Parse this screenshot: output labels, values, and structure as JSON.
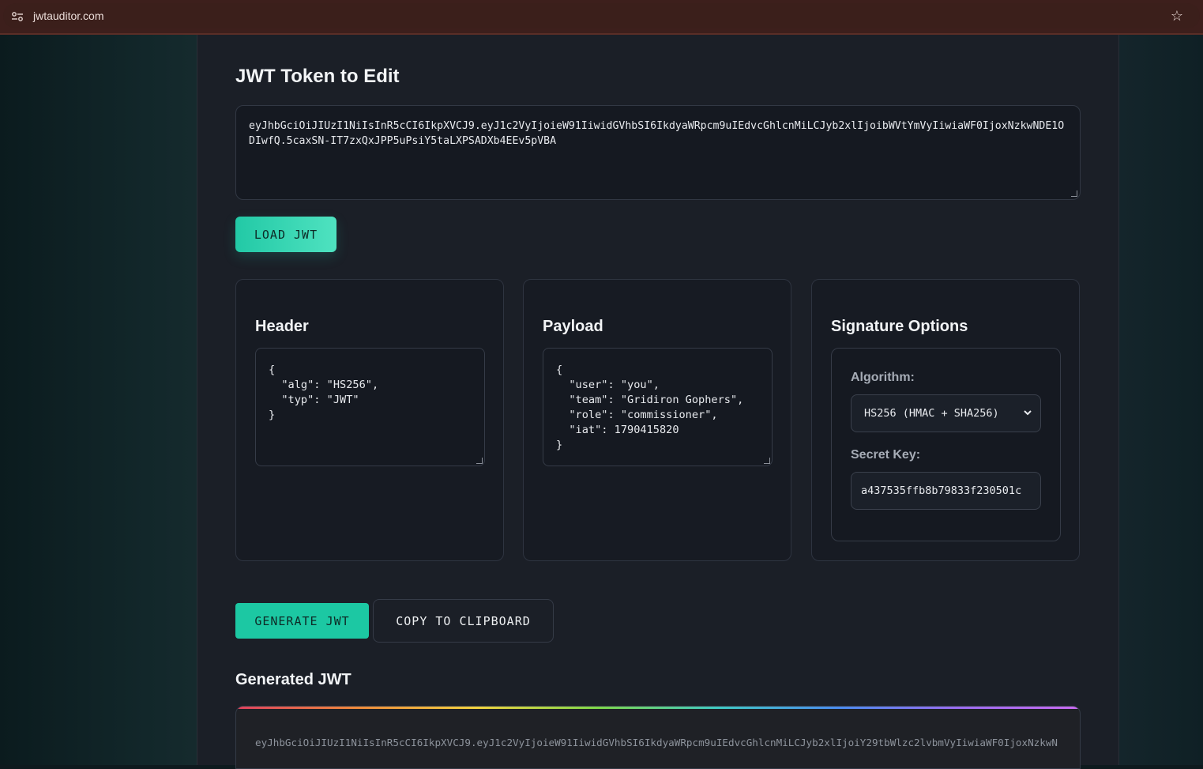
{
  "browser": {
    "url": "jwtauditor.com"
  },
  "editor": {
    "title": "JWT Token to Edit",
    "token": "eyJhbGciOiJIUzI1NiIsInR5cCI6IkpXVCJ9.eyJ1c2VyIjoieW91IiwidGVhbSI6IkdyaWRpcm9uIEdvcGhlcnMiLCJyb2xlIjoibWVtYmVyIiwiaWF0IjoxNzkwNDE1ODIwfQ.5caxSN-IT7zxQxJPP5uPsiY5taLXPSADXb4EEv5pVBA",
    "load_button": "LOAD JWT"
  },
  "header_panel": {
    "title": "Header",
    "json": "{\n  \"alg\": \"HS256\",\n  \"typ\": \"JWT\"\n}"
  },
  "payload_panel": {
    "title": "Payload",
    "json": "{\n  \"user\": \"you\",\n  \"team\": \"Gridiron Gophers\",\n  \"role\": \"commissioner\",\n  \"iat\": 1790415820\n}"
  },
  "signature_panel": {
    "title": "Signature Options",
    "algorithm_label": "Algorithm:",
    "algorithm_value": "HS256 (HMAC + SHA256)",
    "secret_label": "Secret Key:",
    "secret_value": "a437535ffb8b79833f230501c"
  },
  "actions": {
    "generate": "GENERATE JWT",
    "copy": "COPY TO CLIPBOARD"
  },
  "output": {
    "title": "Generated JWT",
    "token": "eyJhbGciOiJIUzI1NiIsInR5cCI6IkpXVCJ9.eyJ1c2VyIjoieW91IiwidGVhbSI6IkdyaWRpcm9uIEdvcGhlcnMiLCJyb2xlIjoiY29tbWlzc2lvbmVyIiwiaWF0IjoxNzkwN"
  },
  "colors": {
    "accent": "#1cc8a3",
    "panel": "#171b23",
    "background": "#1b1f27"
  }
}
